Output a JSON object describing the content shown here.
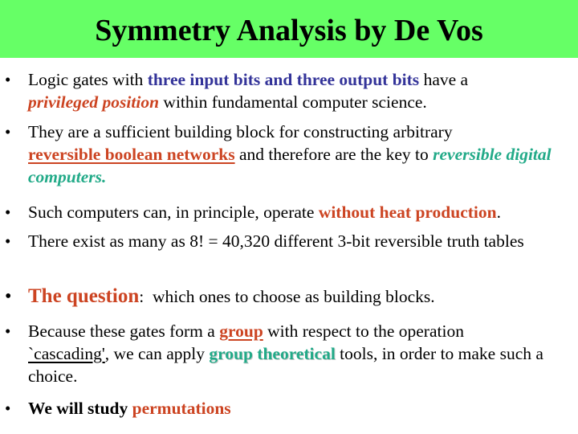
{
  "slide": {
    "title": "Symmetry Analysis by De Vos",
    "bullet_glyph": "•",
    "items": [
      {
        "parts": [
          "Logic gates with ",
          "three input bits and three output bits",
          " have a ",
          "privileged position",
          " within fundamental computer science."
        ]
      },
      {
        "parts": [
          "They are a sufficient building block for constructing arbitrary ",
          "reversible boolean networks",
          " and therefore are the key to ",
          "reversible digital computers",
          "."
        ]
      },
      {
        "parts": [
          "Such computers can, in principle, operate ",
          "without heat production",
          "."
        ]
      },
      {
        "parts": [
          "There exist as many as 8! = 40,320 different 3-bit reversible truth tables"
        ]
      },
      {
        "parts": [
          "The question",
          ":  which ones to choose as building blocks."
        ]
      },
      {
        "parts": [
          "Because these gates form a ",
          "group",
          " with respect to the operation ",
          "`cascading'",
          ", we can apply ",
          "group theoretical",
          " tools, in order to make such a choice."
        ]
      },
      {
        "parts": [
          "We will study ",
          "permutations"
        ]
      }
    ]
  },
  "colors": {
    "title_bar": "#66ff66",
    "blue_emphasis": "#333399",
    "orange_emphasis": "#cc4422",
    "teal_emphasis": "#22aa88"
  }
}
